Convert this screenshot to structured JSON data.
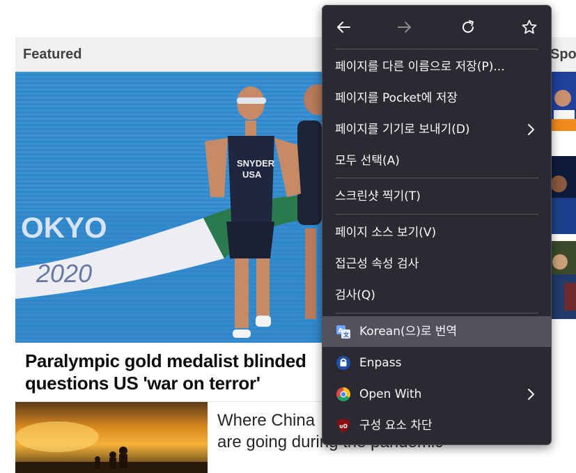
{
  "page": {
    "featured_label": "Featured",
    "spotlight_label": "Spotlight",
    "headline": "Paralympic gold medalist blinded questions US 'war on terror'",
    "headline_line1": "Paralympic gold medalist blinded",
    "headline_line2": "questions US 'war on terror'",
    "story2_line1": "Where China",
    "story2_line2": "are going during the pandemic",
    "hero_bib_name": "SNYDER",
    "hero_bib_country": "USA",
    "hero_banner_text": "OKYO",
    "hero_banner_year": "2020"
  },
  "context_menu": {
    "nav": [
      {
        "name": "back",
        "icon": "arrow-left-icon",
        "enabled": true
      },
      {
        "name": "forward",
        "icon": "arrow-right-icon",
        "enabled": false
      },
      {
        "name": "reload",
        "icon": "reload-icon",
        "enabled": true
      },
      {
        "name": "bookmark",
        "icon": "star-icon",
        "enabled": true
      }
    ],
    "items": [
      {
        "label": "페이지를 다른 이름으로 저장(P)..."
      },
      {
        "label": "페이지를 Pocket에 저장"
      },
      {
        "label": "페이지를 기기로 보내기(D)",
        "submenu": true
      },
      {
        "label": "모두 선택(A)"
      },
      {
        "label": "스크린샷 찍기(T)"
      },
      {
        "label": "페이지 소스 보기(V)"
      },
      {
        "label": "접근성 속성 검사"
      },
      {
        "label": "검사(Q)"
      },
      {
        "label": "Korean(으)로 번역",
        "icon": "translate-icon",
        "highlighted": true
      },
      {
        "label": "Enpass",
        "icon": "enpass-icon"
      },
      {
        "label": "Open With",
        "icon": "chrome-icon",
        "submenu": true
      },
      {
        "label": "구성 요소 차단",
        "icon": "ublock-icon"
      }
    ]
  },
  "colors": {
    "menu_bg": "#2b2a33",
    "menu_highlight": "#52525e",
    "menu_text": "#fbfbfe",
    "section_header_bg": "#f0f0f0",
    "pool_blue": "#2f86c9"
  }
}
